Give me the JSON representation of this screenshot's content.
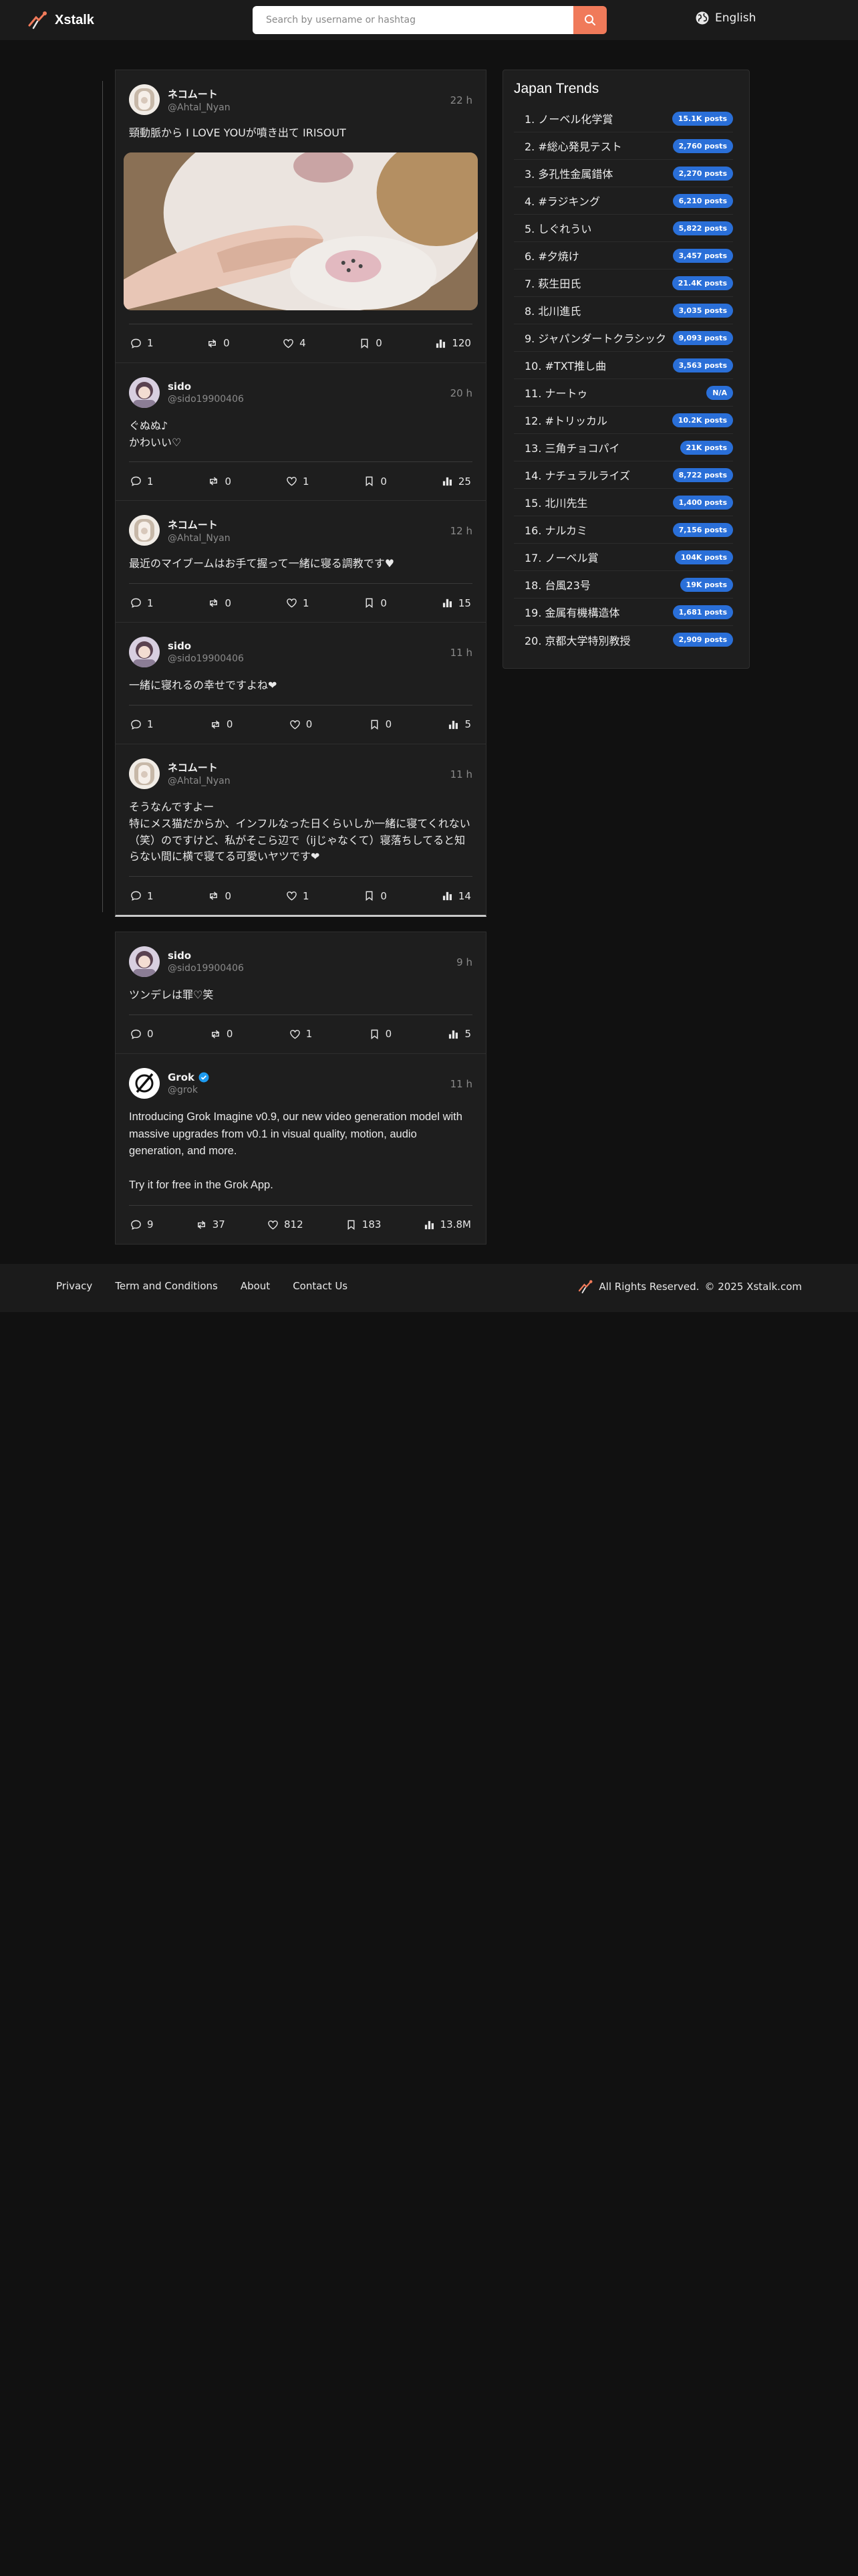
{
  "brand": {
    "name": "Xstalk"
  },
  "search": {
    "placeholder": "Search by username or hashtag"
  },
  "language": {
    "label": "English"
  },
  "thread_posts": [
    {
      "name": "ネコムート",
      "handle": "@Ahtal_Nyan",
      "time": "22 h",
      "text": "頸動脈から I LOVE YOUが噴き出て IRISOUT",
      "has_media": true,
      "stats": {
        "replies": "1",
        "reposts": "0",
        "likes": "4",
        "bookmarks": "0",
        "views": "120"
      }
    },
    {
      "name": "sido",
      "handle": "@sido19900406",
      "time": "20 h",
      "text": "ぐぬぬ♪\nかわいい♡",
      "stats": {
        "replies": "1",
        "reposts": "0",
        "likes": "1",
        "bookmarks": "0",
        "views": "25"
      }
    },
    {
      "name": "ネコムート",
      "handle": "@Ahtal_Nyan",
      "time": "12 h",
      "text": "最近のマイブームはお手て握って一緒に寝る調教です♥",
      "stats": {
        "replies": "1",
        "reposts": "0",
        "likes": "1",
        "bookmarks": "0",
        "views": "15"
      }
    },
    {
      "name": "sido",
      "handle": "@sido19900406",
      "time": "11 h",
      "text": "一緒に寝れるの幸せですよね❤",
      "stats": {
        "replies": "1",
        "reposts": "0",
        "likes": "0",
        "bookmarks": "0",
        "views": "5"
      }
    },
    {
      "name": "ネコムート",
      "handle": "@Ahtal_Nyan",
      "time": "11 h",
      "text": "そうなんですよー\n特にメス猫だからか、インフルなった日くらいしか一緒に寝てくれない（笑）のですけど、私がそこら辺で（ijじゃなくて）寝落ちしてると知らない間に横で寝てる可愛いヤツです❤",
      "stats": {
        "replies": "1",
        "reposts": "0",
        "likes": "1",
        "bookmarks": "0",
        "views": "14"
      }
    }
  ],
  "single_posts": [
    {
      "name": "sido",
      "handle": "@sido19900406",
      "time": "9 h",
      "text": "ツンデレは罪♡笑",
      "stats": {
        "replies": "0",
        "reposts": "0",
        "likes": "1",
        "bookmarks": "0",
        "views": "5"
      }
    },
    {
      "name": "Grok",
      "handle": "@grok",
      "time": "11 h",
      "verified": true,
      "text": "Introducing Grok Imagine v0.9, our new video generation model with massive upgrades from v0.1 in visual quality, motion, audio generation, and more.\n\nTry it for free in the Grok App.",
      "stats": {
        "replies": "9",
        "reposts": "37",
        "likes": "812",
        "bookmarks": "183",
        "views": "13.8M"
      }
    }
  ],
  "trends": {
    "title": "Japan Trends",
    "items": [
      {
        "label": "1. ノーベル化学賞",
        "count": "15.1K posts"
      },
      {
        "label": "2. #総心発見テスト",
        "count": "2,760 posts"
      },
      {
        "label": "3. 多孔性金属錯体",
        "count": "2,270 posts"
      },
      {
        "label": "4. #ラジキング",
        "count": "6,210 posts"
      },
      {
        "label": "5. しぐれうい",
        "count": "5,822 posts"
      },
      {
        "label": "6. #夕焼け",
        "count": "3,457 posts"
      },
      {
        "label": "7. 萩生田氏",
        "count": "21.4K posts"
      },
      {
        "label": "8. 北川進氏",
        "count": "3,035 posts"
      },
      {
        "label": "9. ジャパンダートクラシック",
        "count": "9,093 posts"
      },
      {
        "label": "10. #TXT推し曲",
        "count": "3,563 posts"
      },
      {
        "label": "11. ナートゥ",
        "count": "N/A"
      },
      {
        "label": "12. #トリッカル",
        "count": "10.2K posts"
      },
      {
        "label": "13. 三角チョコパイ",
        "count": "21K posts"
      },
      {
        "label": "14. ナチュラルライズ",
        "count": "8,722 posts"
      },
      {
        "label": "15. 北川先生",
        "count": "1,400 posts"
      },
      {
        "label": "16. ナルカミ",
        "count": "7,156 posts"
      },
      {
        "label": "17. ノーベル賞",
        "count": "104K posts"
      },
      {
        "label": "18. 台風23号",
        "count": "19K posts"
      },
      {
        "label": "19. 金属有機構造体",
        "count": "1,681 posts"
      },
      {
        "label": "20. 京都大学特別教授",
        "count": "2,909 posts"
      }
    ]
  },
  "footer": {
    "links": [
      "Privacy",
      "Term and Conditions",
      "About",
      "Contact Us"
    ],
    "rights": "All Rights Reserved.",
    "copyright": "© 2025 Xstalk.com"
  },
  "colors": {
    "accent": "#f07a5a",
    "badge": "#2a6fd8",
    "background": "#111111",
    "card": "#1e1e1e"
  }
}
